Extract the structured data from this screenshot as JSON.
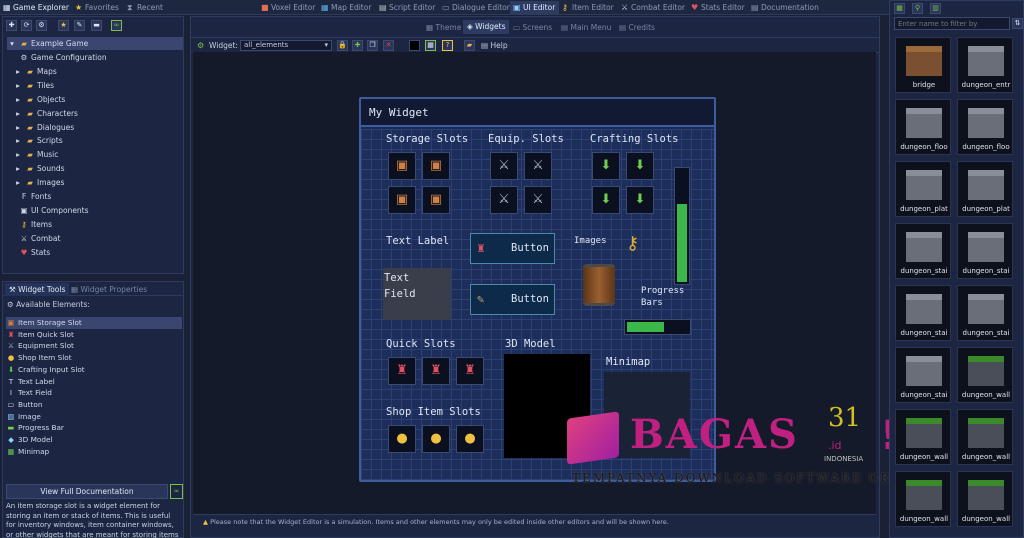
{
  "top_tabs": {
    "game_explorer": "Game Explorer",
    "favorites": "Favorites",
    "recent": "Recent",
    "voxel_editor": "Voxel Editor",
    "map_editor": "Map Editor",
    "script_editor": "Script Editor",
    "dialogue_editor": "Dialogue Editor",
    "ui_editor": "UI Editor",
    "item_editor": "Item Editor",
    "combat_editor": "Combat Editor",
    "stats_editor": "Stats Editor",
    "documentation": "Documentation"
  },
  "sub_tabs": {
    "theme": "Theme",
    "widgets": "Widgets",
    "screens": "Screens",
    "main_menu": "Main Menu",
    "credits": "Credits"
  },
  "widget_toolbar": {
    "label": "Widget:",
    "selected": "all_elements",
    "help": "Help"
  },
  "explorer": {
    "root": "Example Game",
    "items": [
      "Game Configuration",
      "Maps",
      "Tiles",
      "Objects",
      "Characters",
      "Dialogues",
      "Scripts",
      "Music",
      "Sounds",
      "Images",
      "Fonts",
      "UI Components",
      "Items",
      "Combat",
      "Stats"
    ]
  },
  "widget_tools": {
    "tab_tools": "Widget Tools",
    "tab_props": "Widget Properties",
    "available": "Available Elements:",
    "elements": [
      "Item Storage Slot",
      "Item Quick Slot",
      "Equipment Slot",
      "Shop Item Slot",
      "Crafting Input Slot",
      "Text Label",
      "Text Field",
      "Button",
      "Image",
      "Progress Bar",
      "3D Model",
      "Minimap"
    ],
    "view_docs": "View Full Documentation",
    "description": "An item storage slot is a widget element for storing an item or stack of items. This is useful for inventory windows, item container windows, or other widgets that are meant for storing items into for later retrieval"
  },
  "widget": {
    "title": "My Widget",
    "storage_slots": "Storage Slots",
    "equip_slots": "Equip. Slots",
    "crafting_slots": "Crafting Slots",
    "text_label": "Text Label",
    "text_field": "Text\nField",
    "button1": "Button",
    "button2": "Button",
    "images": "Images",
    "progress_bars": "Progress\nBars",
    "quick_slots": "Quick Slots",
    "model_3d": "3D Model",
    "minimap": "Minimap",
    "shop_slots": "Shop Item Slots",
    "vertical_progress": 0.7,
    "horizontal_progress": 0.6
  },
  "assets": {
    "filter_placeholder": "Enter name to filter by",
    "items": [
      "bridge",
      "dungeon_entr",
      "dungeon_floo",
      "dungeon_floo",
      "dungeon_plat",
      "dungeon_plat",
      "dungeon_stai",
      "dungeon_stai",
      "dungeon_stai",
      "dungeon_stai",
      "dungeon_stai",
      "dungeon_wall",
      "dungeon_wall",
      "dungeon_wall",
      "dungeon_wall",
      "dungeon_wall"
    ]
  },
  "watermark": {
    "brand": "BAGAS",
    "number": "31",
    "suffix": ".id",
    "country": "INDONESIA",
    "tagline": "TEMPATNYA DOWNLOAD SOFTWARE GRATIS"
  },
  "status": {
    "hint": "Please note that the Widget Editor is a simulation. Items and other elements may only be edited inside other editors and will be shown here."
  }
}
